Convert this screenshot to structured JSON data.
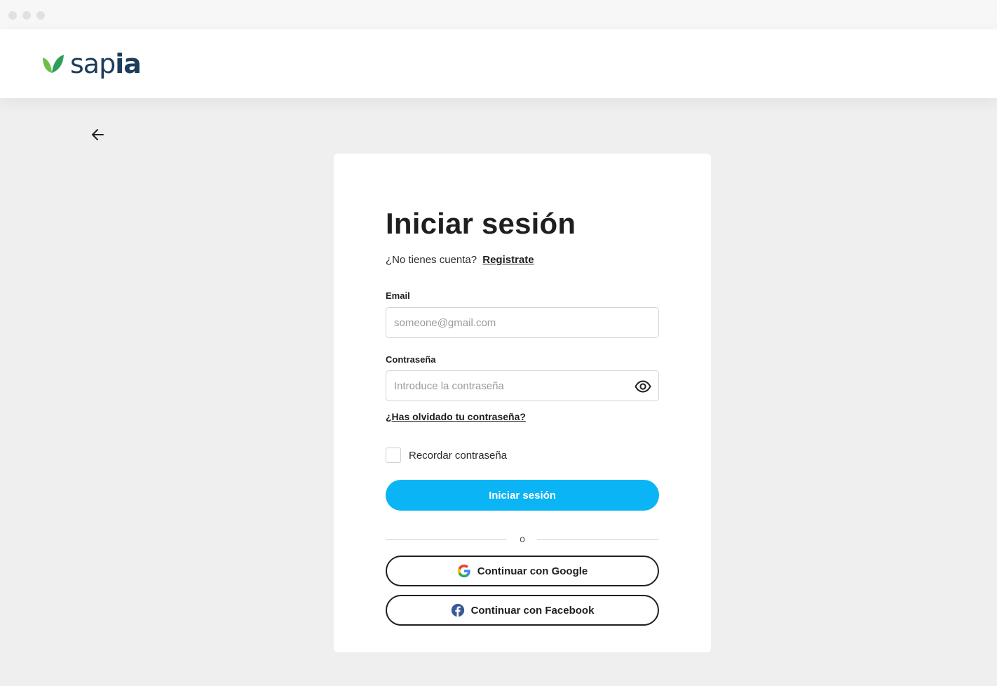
{
  "brand": {
    "name_light": "sap",
    "name_bold": "ia",
    "colors": {
      "navy": "#1d3d5c",
      "leaf_green": "#6cc04a",
      "leaf_dark": "#2e9e5b"
    }
  },
  "window": {
    "dots": [
      "dot",
      "dot",
      "dot"
    ]
  },
  "navigation": {
    "back_icon": "arrow-left-icon"
  },
  "login": {
    "title": "Iniciar sesión",
    "no_account_text": "¿No tienes cuenta?",
    "register_link": "Registrate",
    "email_label": "Email",
    "email_placeholder": "someone@gmail.com",
    "password_label": "Contraseña",
    "password_placeholder": "Introduce la contraseña",
    "password_toggle_icon": "eye-icon",
    "forgot_link": "¿Has olvidado tu contraseña?",
    "remember_label": "Recordar contraseña",
    "remember_checked": false,
    "submit_label": "Iniciar sesión",
    "submit_color": "#0bb4f4",
    "divider_text": "o",
    "google_label": "Continuar con Google",
    "google_icon": "google-icon",
    "facebook_label": "Continuar con Facebook",
    "facebook_icon": "facebook-icon"
  }
}
